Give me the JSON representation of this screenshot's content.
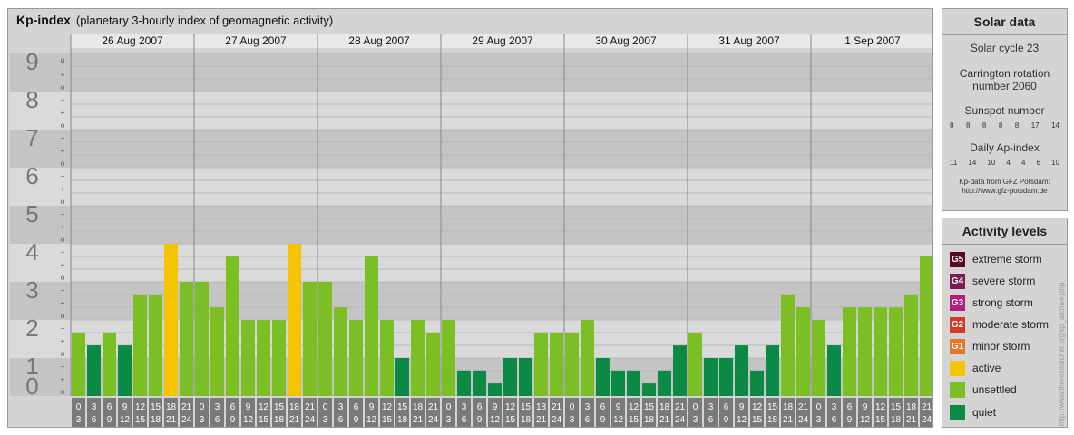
{
  "header": {
    "title": "Kp-index",
    "subtitle": "(planetary 3-hourly index of geomagnetic activity)"
  },
  "chart_data": {
    "type": "bar",
    "days": [
      "26 Aug 2007",
      "27 Aug 2007",
      "28 Aug 2007",
      "29 Aug 2007",
      "30 Aug 2007",
      "31 Aug 2007",
      "1 Sep 2007"
    ],
    "interval_top": [
      "0",
      "3",
      "6",
      "9",
      "12",
      "15",
      "18",
      "21"
    ],
    "interval_bottom": [
      "3",
      "6",
      "9",
      "12",
      "15",
      "18",
      "21",
      "24"
    ],
    "y_labels": [
      "0",
      "1",
      "2",
      "3",
      "4",
      "5",
      "6",
      "7",
      "8",
      "9"
    ],
    "sub_tick_labels": [
      "o",
      "+",
      "−"
    ],
    "ylim": [
      0,
      9
    ],
    "values": [
      1.67,
      1.33,
      1.67,
      1.33,
      2.67,
      2.67,
      4.0,
      3.0,
      3.0,
      2.33,
      3.67,
      2.0,
      2.0,
      2.0,
      4.0,
      3.0,
      3.0,
      2.33,
      2.0,
      3.67,
      2.0,
      1.0,
      2.0,
      1.67,
      2.0,
      0.67,
      0.67,
      0.33,
      1.0,
      1.0,
      1.67,
      1.67,
      1.67,
      2.0,
      1.0,
      0.67,
      0.67,
      0.33,
      0.67,
      1.33,
      1.67,
      1.0,
      1.0,
      1.33,
      0.67,
      1.33,
      2.67,
      2.33,
      2.0,
      1.33,
      2.33,
      2.33,
      2.33,
      2.33,
      2.67,
      3.67
    ],
    "colors": {
      "quiet": "#0a8a44",
      "unsettled": "#7bbf24",
      "active": "#f5c400",
      "band_dark": "#c4c4c4",
      "band_light": "#dadada"
    }
  },
  "solar": {
    "title": "Solar data",
    "cycle": "Solar cycle 23",
    "carrington_line1": "Carrington rotation",
    "carrington_line2": "number 2060",
    "sunspot_label": "Sunspot number",
    "sunspot": [
      "8",
      "8",
      "8",
      "8",
      "8",
      "17",
      "14"
    ],
    "ap_label": "Daily Ap-index",
    "ap": [
      "11",
      "14",
      "10",
      "4",
      "4",
      "6",
      "10"
    ],
    "source_line1": "Kp-data from GFZ Potsdam:",
    "source_line2": "http://www.gfz-potsdam.de"
  },
  "levels": {
    "title": "Activity levels",
    "items": [
      {
        "code": "G5",
        "label": "extreme storm",
        "color": "#5a0828"
      },
      {
        "code": "G4",
        "label": "severe storm",
        "color": "#7d1a52"
      },
      {
        "code": "G3",
        "label": "strong storm",
        "color": "#b21e7a"
      },
      {
        "code": "G2",
        "label": "moderate storm",
        "color": "#d23a2a"
      },
      {
        "code": "G1",
        "label": "minor storm",
        "color": "#e3772a"
      },
      {
        "code": "",
        "label": "active",
        "color": "#f5c400"
      },
      {
        "code": "",
        "label": "unsettled",
        "color": "#7bbf24"
      },
      {
        "code": "",
        "label": "quiet",
        "color": "#0a8a44"
      }
    ]
  },
  "side_text": "http://www.theresearcher.org/kp_archive.php"
}
